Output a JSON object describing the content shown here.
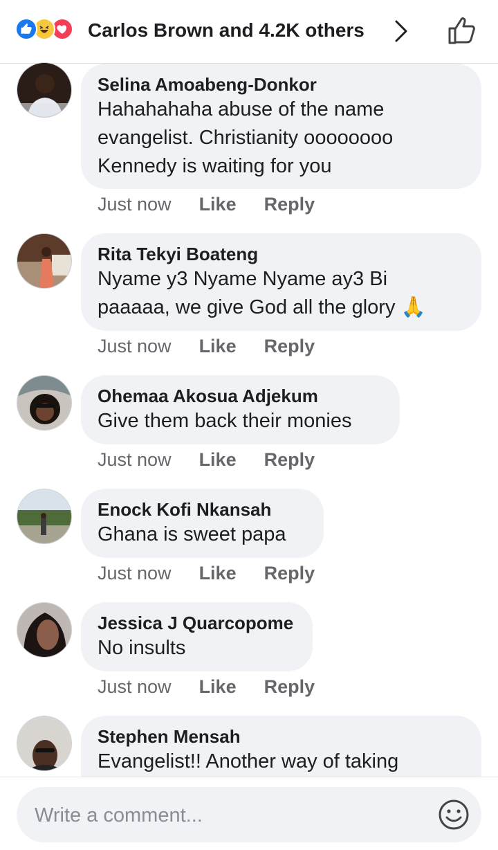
{
  "header": {
    "reactions": [
      "like-reaction",
      "haha-reaction",
      "love-reaction"
    ],
    "likers_text": "Carlos Brown and 4.2K others",
    "like_icon": "thumbs-up-outline-icon",
    "chevron_icon": "chevron-right-icon"
  },
  "comments": [
    {
      "author": "Selina Amoabeng-Donkor",
      "lines": [
        "Hahahahaha abuse of the name",
        "evangelist. Christianity oooooooo",
        "Kennedy is waiting for you"
      ],
      "time": "Just now",
      "like": "Like",
      "reply": "Reply"
    },
    {
      "author": "Rita Tekyi Boateng",
      "lines": [
        "Nyame y3 Nyame  Nyame ay3 Bi",
        "paaaaa, we give God all the glory 🙏"
      ],
      "time": "Just now",
      "like": "Like",
      "reply": "Reply"
    },
    {
      "author": "Ohemaa Akosua Adjekum",
      "lines": [
        "Give them back their monies"
      ],
      "time": "Just now",
      "like": "Like",
      "reply": "Reply"
    },
    {
      "author": "Enock Kofi Nkansah",
      "lines": [
        "Ghana is sweet papa"
      ],
      "time": "Just now",
      "like": "Like",
      "reply": "Reply"
    },
    {
      "author": "Jessica J Quarcopome",
      "lines": [
        "No insults"
      ],
      "time": "Just now",
      "like": "Like",
      "reply": "Reply"
    },
    {
      "author": "Stephen Mensah",
      "lines": [
        "Evangelist!! Another way of taking"
      ]
    }
  ],
  "composer": {
    "placeholder": "Write a comment...",
    "emoji_icon": "smiley-icon"
  },
  "colors": {
    "bubble": "#f0f2f5",
    "like_blue": "#1877f2",
    "meta_gray": "#65676b"
  }
}
